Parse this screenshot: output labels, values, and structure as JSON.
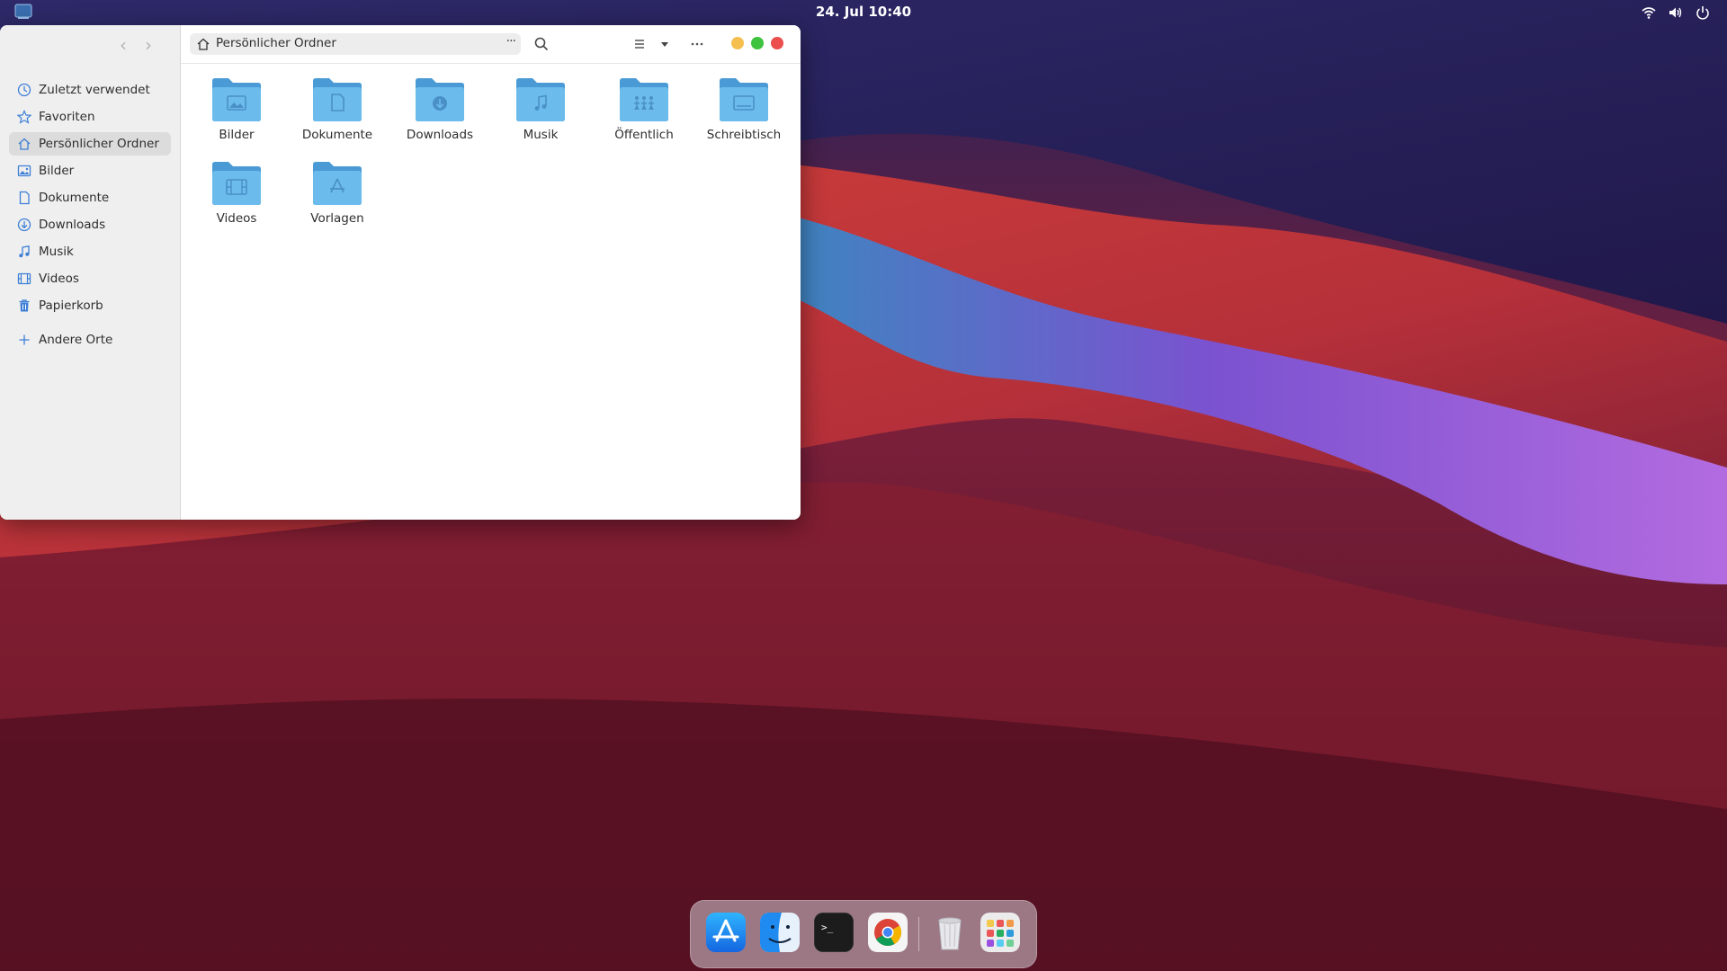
{
  "topbar": {
    "clock": "24. Jul  10:40",
    "tray_icons": [
      "wifi-icon",
      "volume-icon",
      "power-icon"
    ]
  },
  "window": {
    "sidebar": {
      "items": [
        {
          "label": "Zuletzt verwendet",
          "icon": "clock-icon"
        },
        {
          "label": "Favoriten",
          "icon": "star-icon"
        },
        {
          "label": "Persönlicher Ordner",
          "icon": "home-icon",
          "active": true
        },
        {
          "label": "Bilder",
          "icon": "image-icon"
        },
        {
          "label": "Dokumente",
          "icon": "document-icon"
        },
        {
          "label": "Downloads",
          "icon": "download-icon"
        },
        {
          "label": "Musik",
          "icon": "music-icon"
        },
        {
          "label": "Videos",
          "icon": "film-icon"
        },
        {
          "label": "Papierkorb",
          "icon": "trash-icon"
        },
        {
          "label": "Andere Orte",
          "icon": "plus-icon"
        }
      ]
    },
    "pathbar": {
      "location": "Persönlicher Ordner",
      "more": "···"
    },
    "folders": [
      {
        "name": "Bilder",
        "icon": "image-glyph"
      },
      {
        "name": "Dokumente",
        "icon": "document-glyph"
      },
      {
        "name": "Downloads",
        "icon": "download-glyph"
      },
      {
        "name": "Musik",
        "icon": "music-glyph"
      },
      {
        "name": "Öffentlich",
        "icon": "people-glyph"
      },
      {
        "name": "Schreibtisch",
        "icon": "desktop-glyph"
      },
      {
        "name": "Videos",
        "icon": "film-glyph"
      },
      {
        "name": "Vorlagen",
        "icon": "templates-glyph"
      }
    ],
    "window_controls": {
      "minimize": "#f4bf4f",
      "maximize": "#3ec33e",
      "close": "#ec4d4d"
    },
    "folder_color": "#5aaee4"
  },
  "dock": {
    "apps": [
      "app-store",
      "files",
      "terminal",
      "chrome",
      "trash",
      "app-grid"
    ],
    "terminal_prompt": ">_"
  }
}
